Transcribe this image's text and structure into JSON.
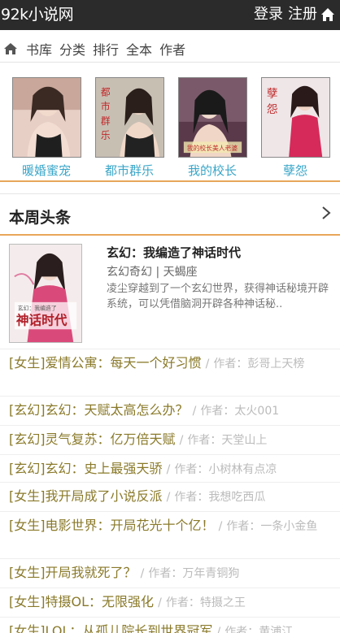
{
  "header": {
    "site_title": "92k小说网",
    "login": "登录",
    "register": "注册"
  },
  "nav": {
    "items": [
      "书库",
      "分类",
      "排行",
      "全本",
      "作者"
    ]
  },
  "covers": [
    {
      "title": "暖婚蜜宠",
      "cover_text": ""
    },
    {
      "title": "都市群乐",
      "cover_text": "都市群乐"
    },
    {
      "title": "我的校长",
      "cover_text": "我的校长美人老婆"
    },
    {
      "title": "孽怨",
      "cover_text": "孽 怨"
    }
  ],
  "section": {
    "title": "本周头条"
  },
  "feature": {
    "title": "玄幻：我编造了神话时代",
    "meta": "玄幻奇幻 | 天蝎座",
    "desc": "凌尘穿越到了一个玄幻世界，获得神话秘境开辟系统，可以凭借脑洞开辟各种神话秘..",
    "cover_text": "神话时代",
    "cover_sub": "玄幻：我编造了"
  },
  "list": [
    {
      "cat": "[女生]",
      "name": "爱情公寓：每天一个好习惯",
      "author": "作者：彭哥上天榜"
    },
    {
      "cat": "[玄幻]",
      "name": "玄幻：天赋太高怎么办？",
      "author": "作者：太火001"
    },
    {
      "cat": "[玄幻]",
      "name": "灵气复苏：亿万倍天赋",
      "author": "作者：天堂山上"
    },
    {
      "cat": "[玄幻]",
      "name": "玄幻：史上最强天骄",
      "author": "作者：小树林有点凉"
    },
    {
      "cat": "[女生]",
      "name": "我开局成了小说反派",
      "author": "作者：我想吃西瓜"
    },
    {
      "cat": "[女生]",
      "name": "电影世界：开局花光十个亿！",
      "author": "作者：一条小金鱼"
    },
    {
      "cat": "[女生]",
      "name": "开局我就死了？",
      "author": "作者：万年青铜狗"
    },
    {
      "cat": "[女生]",
      "name": "特摄OL：无限强化",
      "author": "作者：特摄之王"
    },
    {
      "cat": "[女生]",
      "name": "LOL：从孤儿院长到世界冠军",
      "author": "作者：黄浦江"
    }
  ],
  "colors": {
    "accent": "#e8a65a",
    "topbar": "#2b2b2b",
    "cover_title": "#3aa6c8",
    "list_title": "#8a7a2a"
  }
}
